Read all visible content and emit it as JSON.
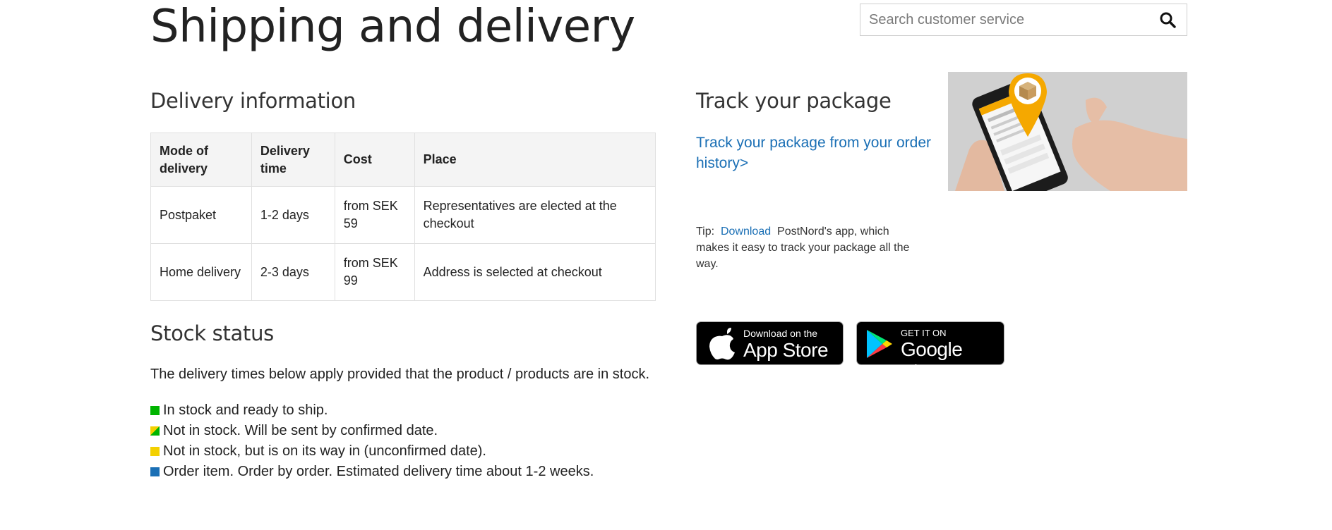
{
  "page": {
    "title": "Shipping and delivery"
  },
  "search": {
    "placeholder": "Search customer service",
    "icon": "search-icon"
  },
  "delivery": {
    "heading": "Delivery information",
    "columns": [
      "Mode of delivery",
      "Delivery time",
      "Cost",
      "Place"
    ],
    "rows": [
      {
        "mode": "Postpaket",
        "time": "1-2 days",
        "cost": "from SEK 59",
        "place": "Representatives are elected at the checkout"
      },
      {
        "mode": "Home delivery",
        "time": "2-3 days",
        "cost": "from SEK 99",
        "place": "Address is selected at checkout"
      }
    ]
  },
  "stock": {
    "heading": "Stock status",
    "intro": "The delivery times below apply provided that the product / products are in stock.",
    "items": [
      {
        "label": "In stock and ready to ship.",
        "color": "#00b400"
      },
      {
        "label": "Not in stock. Will be sent by confirmed date.",
        "color": "split-yellow-green"
      },
      {
        "label": "Not in stock, but is on its way in (unconfirmed date).",
        "color": "#f3d000"
      },
      {
        "label": "Order item. Order by order. Estimated delivery time about 1-2 weeks.",
        "color": "#1a6fb5"
      }
    ]
  },
  "tracking": {
    "heading": "Track your package",
    "link": "Track your package from your order history>",
    "tip_prefix": "Tip:",
    "tip_link": "Download",
    "tip_text": "PostNord's app, which makes it easy to track your package all the way."
  },
  "apps": {
    "appstore_small": "Download on the",
    "appstore_big": "App Store",
    "googleplay_small": "GET IT ON",
    "googleplay_big": "Google Play"
  },
  "colors": {
    "link": "#1a6fb5",
    "accent": "#f5a800"
  }
}
